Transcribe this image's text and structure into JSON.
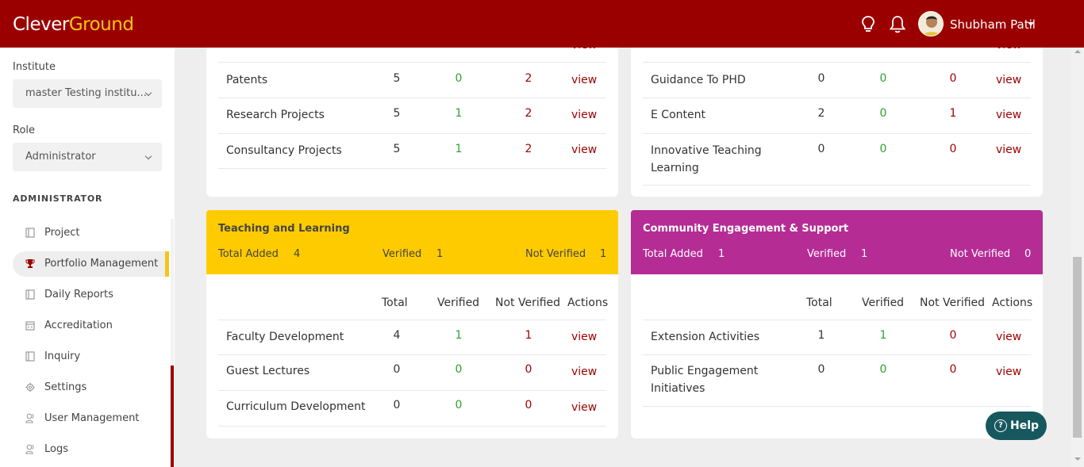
{
  "header": {
    "logo_part1": "Clever",
    "logo_part2": "Ground",
    "user_name": "Shubham Patil",
    "icons": [
      "lightbulb-icon",
      "bell-icon"
    ]
  },
  "sidebar": {
    "institute_label": "Institute",
    "institute_value": "master Testing institu...",
    "role_label": "Role",
    "role_value": "Administrator",
    "section_title": "ADMINISTRATOR",
    "items": [
      {
        "label": "Project",
        "icon": "document-icon"
      },
      {
        "label": "Portfolio Management",
        "icon": "trophy-icon",
        "active": true
      },
      {
        "label": "Daily Reports",
        "icon": "document-icon"
      },
      {
        "label": "Accreditation",
        "icon": "calendar-icon"
      },
      {
        "label": "Inquiry",
        "icon": "document-icon"
      },
      {
        "label": "Settings",
        "icon": "gear-icon"
      },
      {
        "label": "User Management",
        "icon": "users-icon"
      },
      {
        "label": "Logs",
        "icon": "users-icon"
      }
    ]
  },
  "colors": {
    "brand": "#9b0000",
    "accent_yellow": "#fecb00",
    "accent_magenta": "#b52c95",
    "verified_green": "#2ea12e",
    "help_teal": "#17585f"
  },
  "common": {
    "view": "view",
    "col_total": "Total",
    "col_verified": "Verified",
    "col_not_verified": "Not Verified",
    "col_actions": "Actions",
    "lbl_total_added": "Total Added",
    "lbl_verified": "Verified",
    "lbl_not_verified": "Not Verified"
  },
  "research_card": {
    "partial_view": "view",
    "rows": [
      {
        "name": "Patents",
        "total": "5",
        "verified": "0",
        "not_verified": "2"
      },
      {
        "name": "Research Projects",
        "total": "5",
        "verified": "1",
        "not_verified": "2"
      },
      {
        "name": "Consultancy Projects",
        "total": "5",
        "verified": "1",
        "not_verified": "2"
      }
    ]
  },
  "teaching_misc_card": {
    "partial_view": "view",
    "rows": [
      {
        "name": "Guidance To PHD",
        "total": "0",
        "verified": "0",
        "not_verified": "0"
      },
      {
        "name": "E Content",
        "total": "2",
        "verified": "0",
        "not_verified": "1"
      },
      {
        "name": "Innovative Teaching",
        "name2": "Learning",
        "total": "0",
        "verified": "0",
        "not_verified": "0"
      }
    ]
  },
  "teaching_card": {
    "title": "Teaching and Learning",
    "total_added": "4",
    "verified": "1",
    "not_verified": "1",
    "rows": [
      {
        "name": "Faculty Development",
        "total": "4",
        "verified": "1",
        "not_verified": "1"
      },
      {
        "name": "Guest Lectures",
        "total": "0",
        "verified": "0",
        "not_verified": "0"
      },
      {
        "name": "Curriculum Development",
        "total": "0",
        "verified": "0",
        "not_verified": "0"
      }
    ]
  },
  "community_card": {
    "title": "Community Engagement & Support",
    "total_added": "1",
    "verified": "1",
    "not_verified": "0",
    "rows": [
      {
        "name": "Extension Activities",
        "total": "1",
        "verified": "1",
        "not_verified": "0"
      },
      {
        "name": "Public Engagement",
        "name2": "Initiatives",
        "total": "0",
        "verified": "0",
        "not_verified": "0"
      }
    ]
  },
  "help_button": "Help"
}
